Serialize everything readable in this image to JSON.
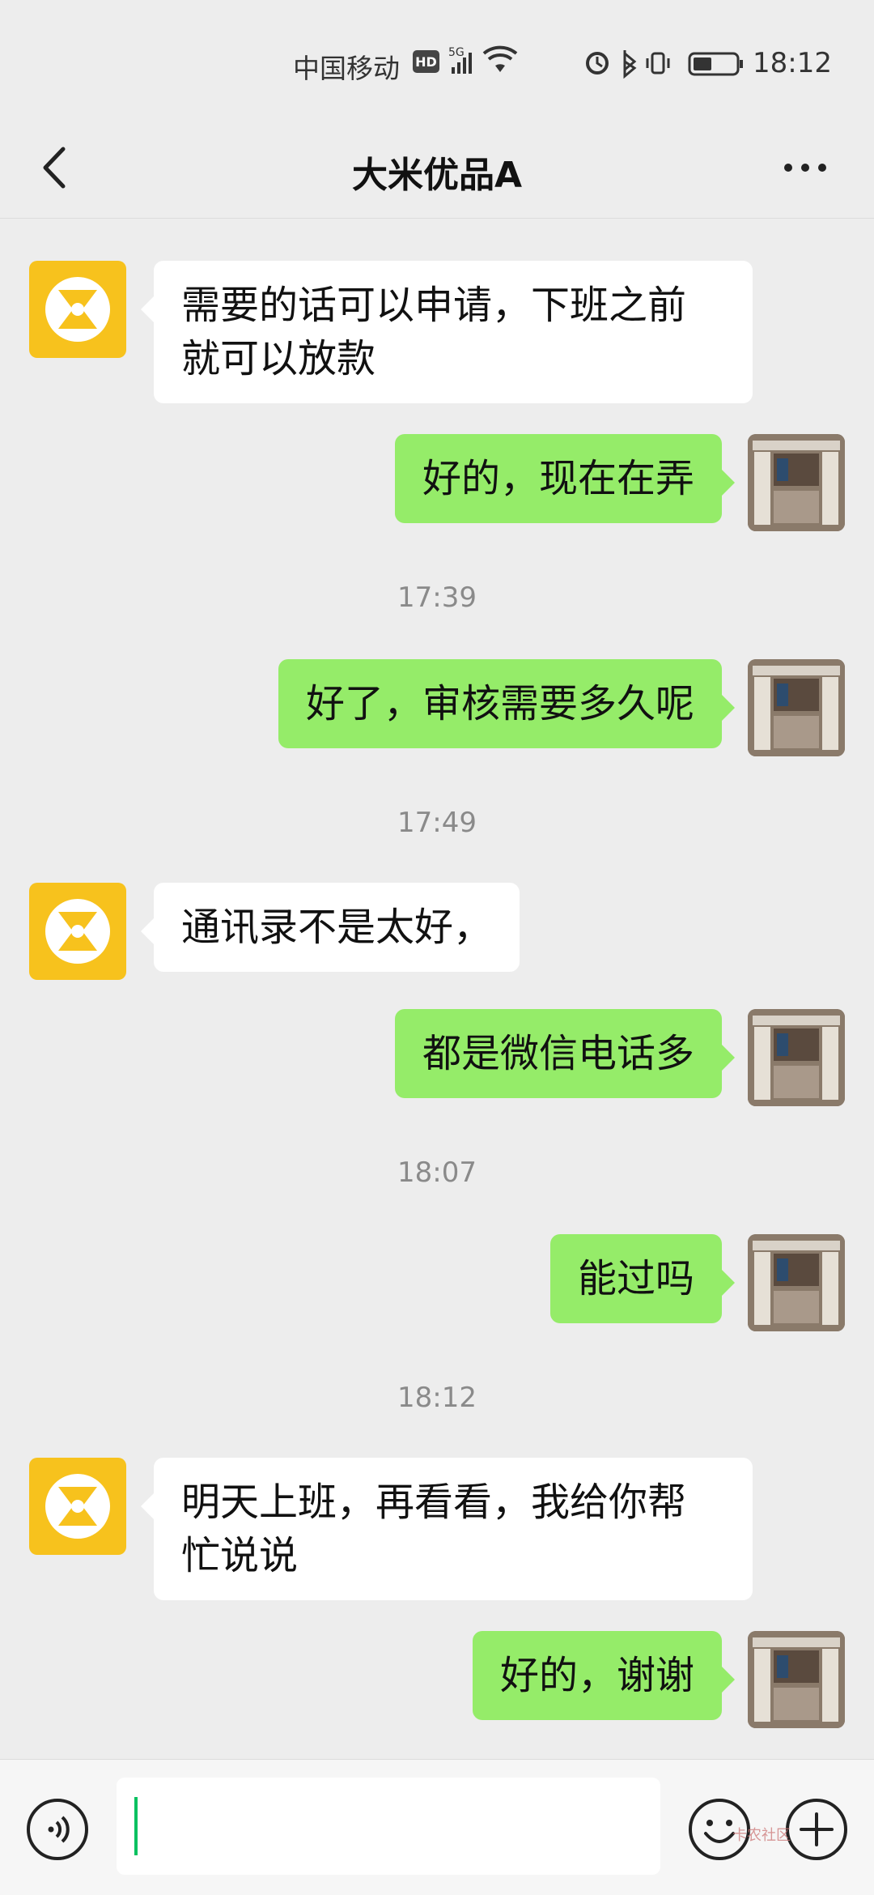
{
  "status_bar": {
    "carrier": "中国移动",
    "hd_badge": "HD",
    "network": "5G",
    "time": "18:12"
  },
  "chat": {
    "title": "大米优品A",
    "back_icon": "chevron-left-icon",
    "more_icon": "more-dots-icon"
  },
  "messages": [
    {
      "side": "left",
      "lines": [
        "需要的话可以申请，下班之前",
        "就可以放款"
      ]
    },
    {
      "side": "right",
      "text": "好的，现在在弄"
    },
    {
      "time": "17:39"
    },
    {
      "side": "right",
      "text": "好了，审核需要多久呢"
    },
    {
      "time": "17:49"
    },
    {
      "side": "left",
      "text": "通讯录不是太好，"
    },
    {
      "side": "right",
      "text": "都是微信电话多"
    },
    {
      "time": "18:07"
    },
    {
      "side": "right",
      "text": "能过吗"
    },
    {
      "time": "18:12"
    },
    {
      "side": "left",
      "lines": [
        "明天上班，再看看，我给你帮",
        "忙说说"
      ]
    },
    {
      "side": "right",
      "text": "好的，谢谢"
    }
  ],
  "input_bar": {
    "voice_icon": "voice-icon",
    "input_value": "",
    "emoji_icon": "emoji-icon",
    "plus_icon": "plus-icon"
  },
  "watermark": "卡农社区",
  "colors": {
    "background": "#ededed",
    "bubble_left": "#ffffff",
    "bubble_right": "#95ec69",
    "avatar_contact": "#f7c21d",
    "caret": "#07c160"
  }
}
